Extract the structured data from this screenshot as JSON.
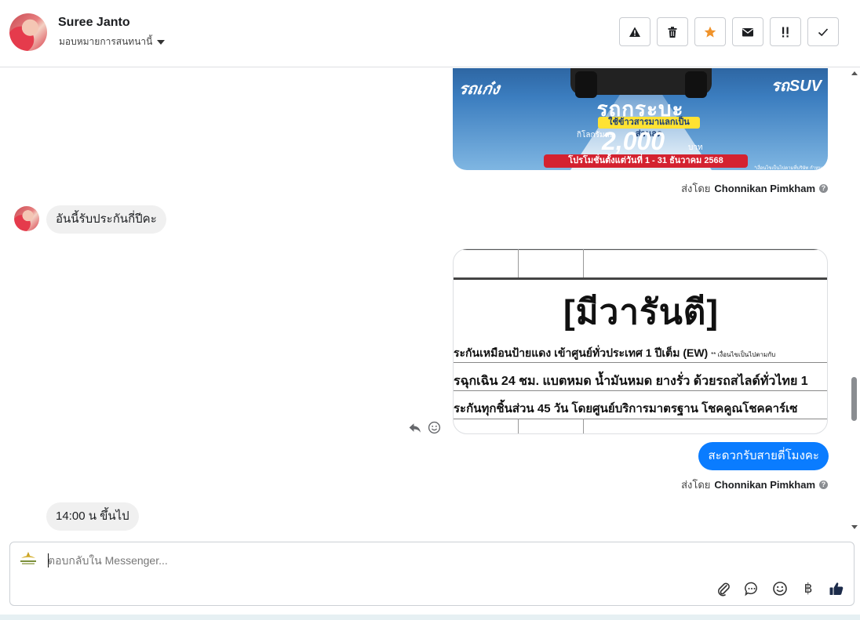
{
  "header": {
    "contact_name": "Suree Janto",
    "assign_label": "มอบหมายการสนทนานี้",
    "toolbar": [
      {
        "icon": "warning-icon",
        "action": "spam"
      },
      {
        "icon": "trash-icon",
        "action": "delete"
      },
      {
        "icon": "star-icon",
        "action": "star",
        "color": "#f0932b"
      },
      {
        "icon": "envelope-icon",
        "action": "mark-unread"
      },
      {
        "icon": "follow-up-icon",
        "action": "follow-up"
      },
      {
        "icon": "checkmark-icon",
        "action": "done"
      }
    ]
  },
  "thread": {
    "ad_image": {
      "left_label": "รถเก๋ง",
      "right_label": "รถSUV",
      "title": "รถกระบะ",
      "yellow_banner": "ใช้ข้าวสารมาแลกเป็นส่วนลด",
      "price_label": "กิโลกรัมละ",
      "price": "2,000",
      "price_unit": "บาท",
      "promo": "โปรโมชั่นตั้งแต่วันที่ 1 - 31 ธันวาคม 2568",
      "note": "*เงื่อนไขเป็นไปตามที่บริษัท กำหนด"
    },
    "sender_1": {
      "prefix": "ส่งโดย",
      "name": "Chonnikan Pimkham"
    },
    "incoming_1": "อันนี้รับประกันกี่ปีคะ",
    "warranty_image": {
      "title": "[มีวารันตี]",
      "row1": "ระกันเหมือนป้ายแดง เข้าศูนย์ทั่วประเทศ 1 ปีเต็ม (EW)",
      "row1_note": "** เงื่อนไขเป็นไปตามกับ",
      "row2": "รฉุกเฉิน 24 ชม. แบตหมด น้ำมันหมด ยางรั่ว ด้วยรถสไลด์ทั่วไทย 1",
      "row3": "ระกันทุกชิ้นส่วน 45 วัน โดยศูนย์บริการมาตรฐาน โชคคูณโชคคาร์เซ"
    },
    "outgoing_1": "สะดวกรับสายตี่โมงคะ",
    "sender_2": {
      "prefix": "ส่งโดย",
      "name": "Chonnikan Pimkham"
    },
    "incoming_2": "14:00 น ขึ้นไป"
  },
  "composer": {
    "placeholder": "ตอบกลับใน Messenger...",
    "baht_symbol": "฿",
    "tools": [
      "attachment-icon",
      "saved-reply-icon",
      "emoji-icon",
      "payment-icon",
      "thumbs-up-icon"
    ]
  },
  "colors": {
    "accent": "#0a7cff",
    "incoming_bubble": "#f0f0f0",
    "star": "#f0932b"
  }
}
